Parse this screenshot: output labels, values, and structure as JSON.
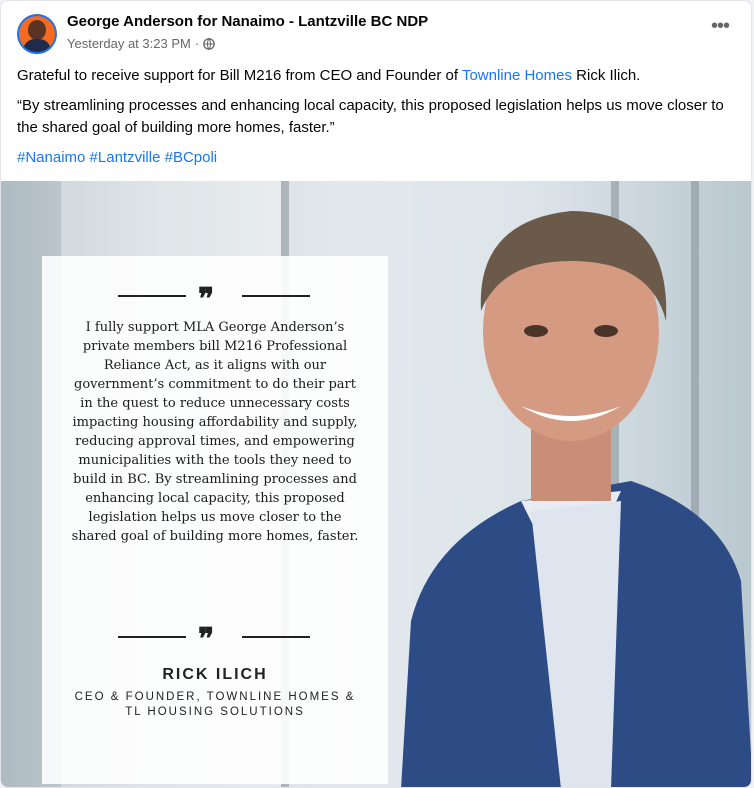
{
  "post": {
    "page_name": "George Anderson for Nanaimo - Lantzville BC NDP",
    "timestamp": "Yesterday at 3:23 PM",
    "separator": "·",
    "privacy_icon": "globe-icon",
    "more_icon": "more-horizontal-icon",
    "more_label": "•••",
    "text": {
      "line1_before": "Grateful to receive support for Bill M216 from CEO and Founder of ",
      "line1_link": "Townline Homes",
      "line1_after": " Rick Ilich.",
      "quote": "“By streamlining processes and enhancing local capacity, this proposed legislation helps us move closer to the shared goal of building more homes, faster.”",
      "hashtags": [
        "#Nanaimo",
        "#Lantzville",
        "#BCpoli"
      ]
    }
  },
  "image": {
    "quote_mark": "❞",
    "quote_text": "I fully support MLA George Anderson’s private members bill M216 Professional Reliance Act, as it aligns with our government’s commitment to do their part in the quest to reduce unnecessary costs impacting housing affordability and supply, reducing approval times, and empowering municipalities with the tools they need to build in BC. By streamlining processes and enhancing local capacity, this proposed legislation helps us move closer to the shared goal of building more homes, faster.",
    "signature_name": "RICK ILICH",
    "signature_title": "CEO & FOUNDER, TOWNLINE HOMES & TL HOUSING SOLUTIONS"
  },
  "colors": {
    "link": "#1877f2",
    "avatar_bg": "#f46a20",
    "jacket": "#2d4c86"
  }
}
